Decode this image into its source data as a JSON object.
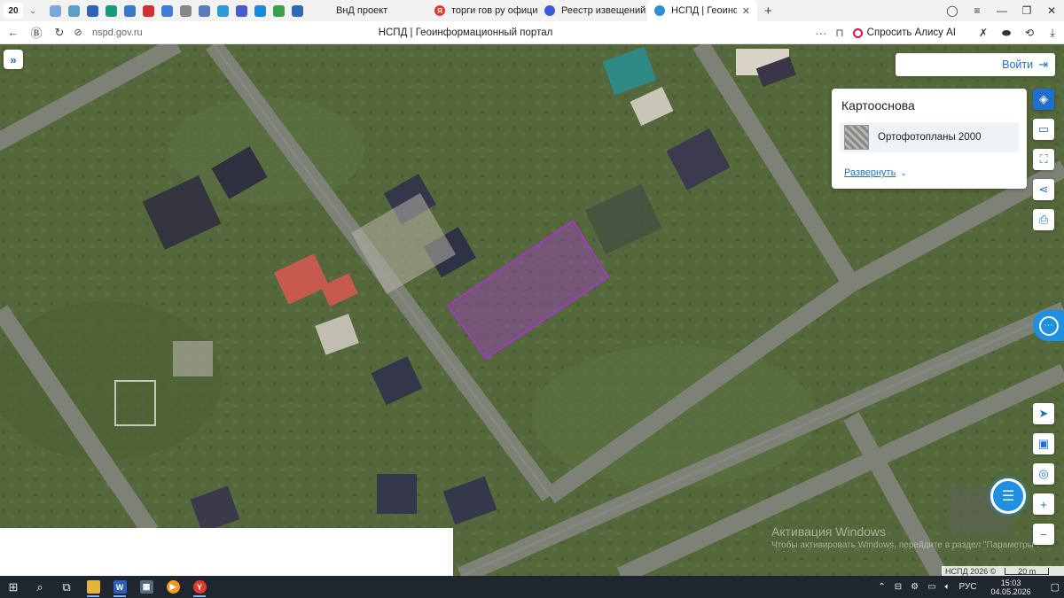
{
  "browser": {
    "tab_count": "20",
    "tabs": [
      {
        "label": "ВнД проект",
        "color": "#3b7dd8"
      },
      {
        "label": "торги гов ру официальны",
        "color": "#e03a2c"
      },
      {
        "label": "Реестр извещений",
        "color": "#3b5bd8"
      },
      {
        "label": "НСПД | Геоинформаци",
        "color": "#2b8fd9"
      }
    ],
    "url": "nspd.gov.ru",
    "page_title": "НСПД | Геоинформационный портал",
    "alice_label": "Спросить Алису AI"
  },
  "map": {
    "login_label": "Войти",
    "basemap": {
      "title": "Картооснова",
      "layer_name": "Ортофотопланы 2000",
      "expand_label": "Развернуть"
    },
    "watermark_title": "Активация Windows",
    "watermark_text": "Чтобы активировать Windows, перейдите в раздел \"Параметры\".",
    "copyright": "НСПД 2026 ©",
    "scale": "20 m",
    "parcel_color": "#a040c0"
  },
  "taskbar": {
    "language": "РУС",
    "time": "15:03",
    "date": "04.05.2026"
  }
}
